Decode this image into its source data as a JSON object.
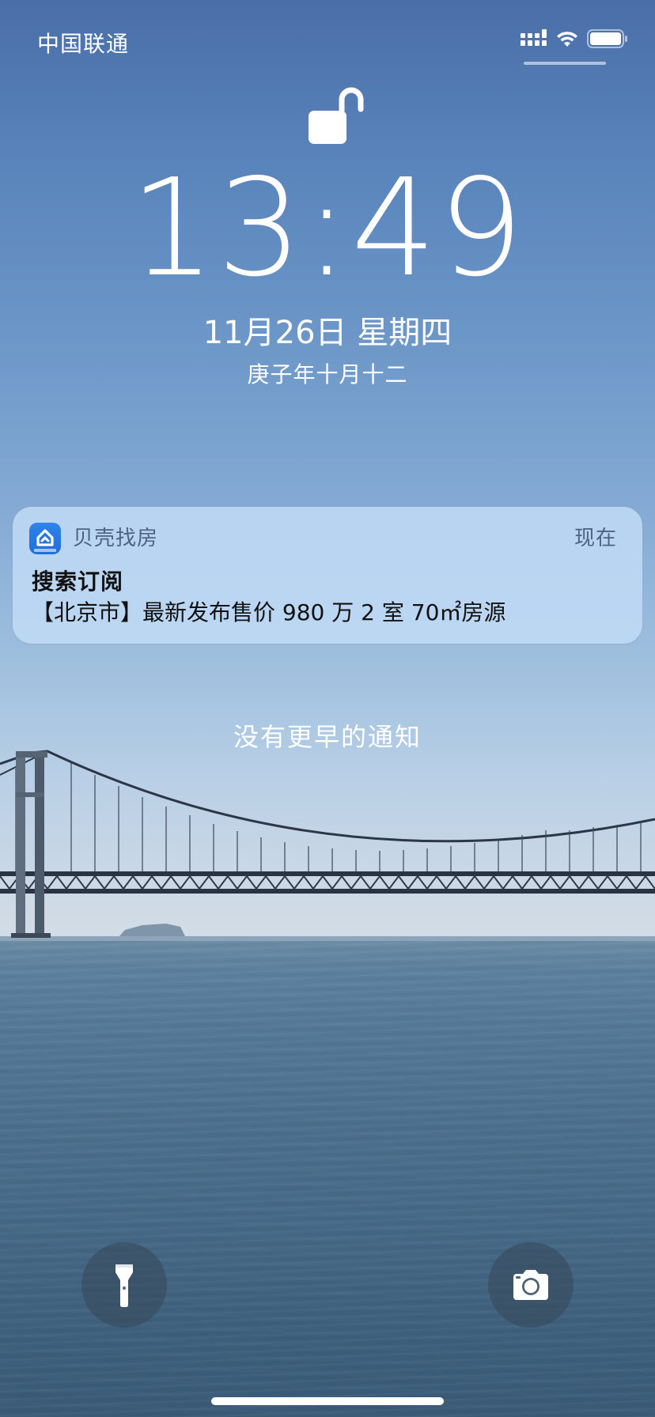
{
  "status_bar": {
    "carrier": "中国联通",
    "signal_icon": "cellular-signal-icon",
    "wifi_icon": "wifi-icon",
    "battery_icon": "battery-icon"
  },
  "lock_screen": {
    "lock_state_icon": "unlocked-padlock-icon",
    "time": "13:49",
    "date": "11月26日 星期四",
    "lunar_date": "庚子年十月十二"
  },
  "notification": {
    "app_icon": "beike-house-icon",
    "app_name": "贝壳找房",
    "time": "现在",
    "title": "搜索订阅",
    "body": "【北京市】最新发布售价 980 万 2 室 70㎡房源"
  },
  "no_earlier_notifications": "没有更早的通知",
  "quick_actions": {
    "flashlight_icon": "flashlight-icon",
    "camera_icon": "camera-icon"
  },
  "colors": {
    "notification_background": "#c3ddf6",
    "app_icon_blue": "#2f83ea",
    "secondary_text": "#4e6380"
  }
}
